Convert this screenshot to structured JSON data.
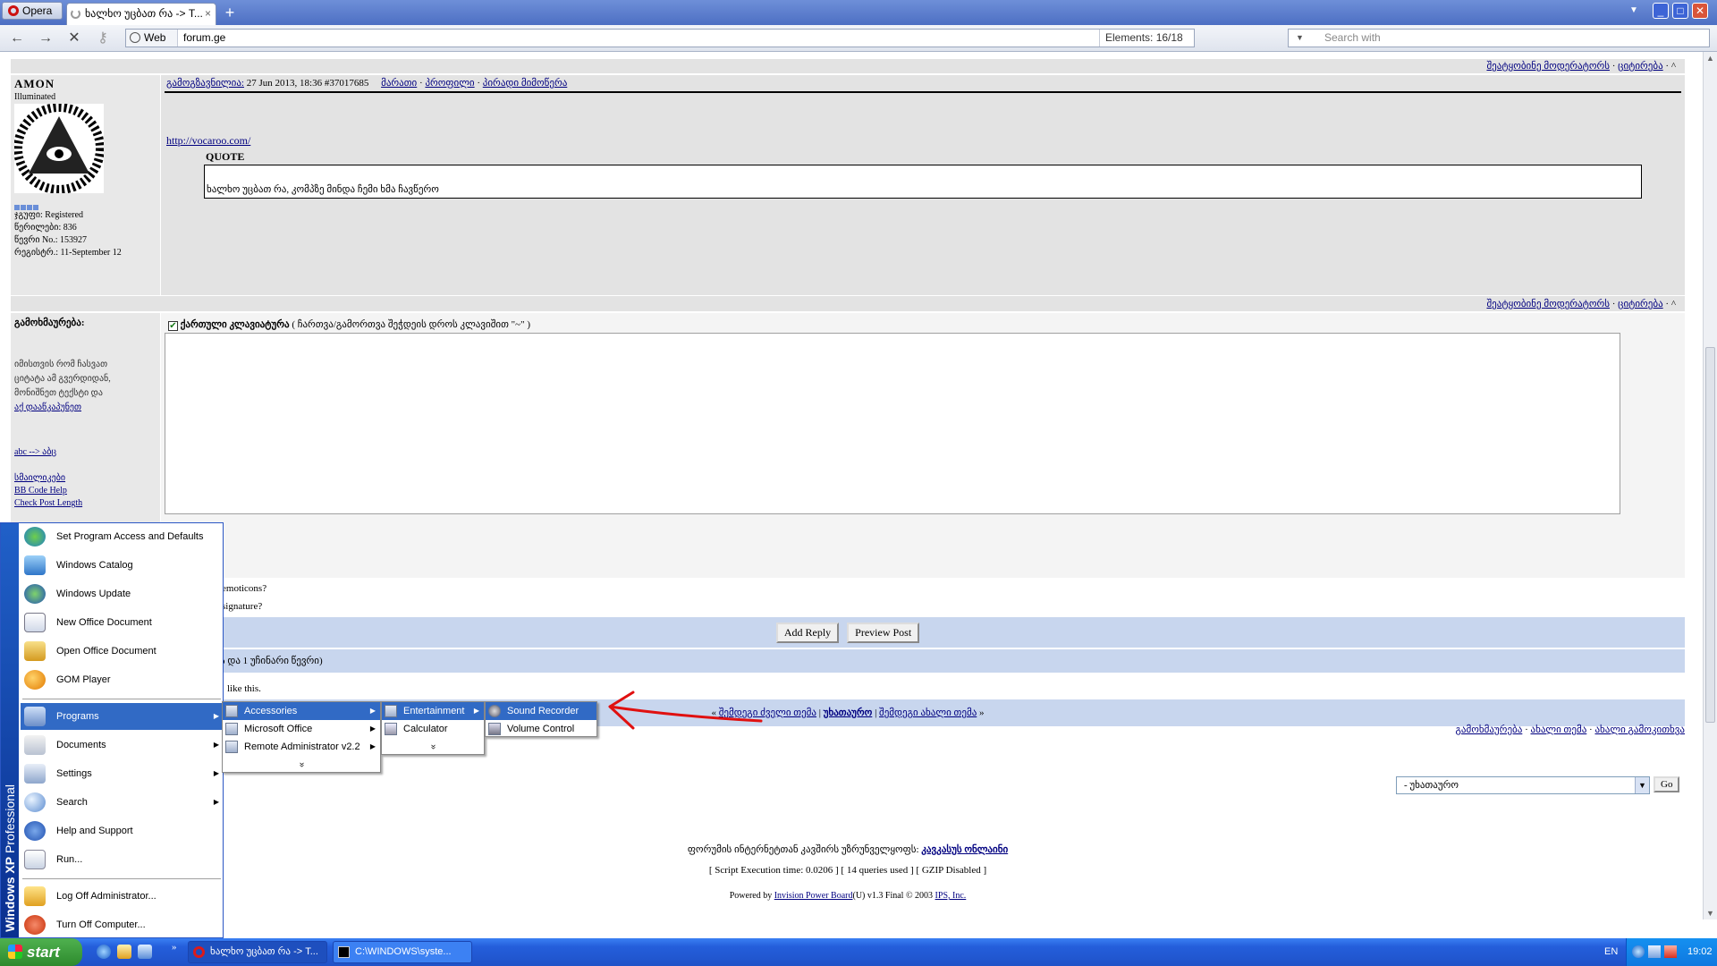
{
  "browser": {
    "menu_label": "Opera",
    "tab_title": "ხალხო უცბათ რა -> T...",
    "tab_close": "×",
    "new_tab": "+",
    "addr_web": "Web",
    "address": "forum.ge",
    "elements": "Elements:   16/18",
    "search_placeholder": "Search with"
  },
  "post": {
    "bar_links": [
      "შეატყობინე მოდერატორს",
      "ციტირება"
    ],
    "author": "AMON",
    "rank": "Illuminated",
    "info": [
      "ჯგუფი: Registered",
      "წერილები: 836",
      "წევრი No.: 153927",
      "რეგისტრ.: 11-September 12"
    ],
    "header_link": "გამოგზავნილია:",
    "header_date": "27 Jun 2013, 18:36",
    "header_num": "#37017685",
    "header_links": [
      "მარათი",
      "პროფილი",
      "პირადი მიმოწერა"
    ],
    "url": "http://vocaroo.com/",
    "quote_label": "QUOTE",
    "quote_text": "ხალხო უცბათ რა, კომპზე მინდა ჩემი ხმა ჩავწერო"
  },
  "reply": {
    "left_title": "გამოხმაურება:",
    "left_hint": [
      "იმისთვის რომ ჩასვათ",
      "ციტატა ამ გვერდიდან,",
      "მონიშნეთ ტექსტი და"
    ],
    "left_links": [
      "აქ დააწკაპუნეთ",
      "abc --> აბც",
      "სმაილიკები",
      "BB Code Help",
      "Check Post Length"
    ],
    "keyboard_label": "ქართული კლავიატურა",
    "keyboard_hint": " ( ჩართვა/გამორთვა შეჭდეის დროს კლავიშით \"~\" )",
    "emoticons": "emoticons?",
    "signature": "signature?",
    "add_reply": "Add Reply",
    "preview": "Preview Post",
    "users_line": "ა და 1 უჩინარი წევრი)",
    "likes": "like this."
  },
  "navigation": {
    "prev_topic": "შემდეგი ძველი თემა",
    "main": "უხათაურო",
    "next_topic": "შემდეგი ახალი თემა",
    "right_links": [
      "გამოხმაურება",
      "ახალი თემა",
      "ახალი გამოკითხვა"
    ],
    "jump_value": "- უხათაურო",
    "go": "Go"
  },
  "footer": {
    "support_prefix": "ფორუმის ინტერნეტთან კავშირს უზრუნველყოფს:",
    "support_link": "კავკასუს ონლაინი",
    "stats": "[ Script Execution time: 0.0206 ]   [ 14 queries used ]   [ GZIP Disabled ]",
    "powered_prefix": "Powered by ",
    "powered_link": "Invision Power Board",
    "powered_mid": "(U) v1.3 Final © 2003  ",
    "ips": "IPS, Inc."
  },
  "startmenu": {
    "side_bold": "Windows XP",
    "side_light": "Professional",
    "items": [
      {
        "label": "Set Program Access and Defaults",
        "arrow": false
      },
      {
        "label": "Windows Catalog",
        "arrow": false
      },
      {
        "label": "Windows Update",
        "arrow": false
      },
      {
        "label": "New Office Document",
        "arrow": false
      },
      {
        "label": "Open Office Document",
        "arrow": false
      },
      {
        "label": "GOM Player",
        "arrow": false
      },
      {
        "label": "Programs",
        "arrow": true
      },
      {
        "label": "Documents",
        "arrow": true
      },
      {
        "label": "Settings",
        "arrow": true
      },
      {
        "label": "Search",
        "arrow": true
      },
      {
        "label": "Help and Support",
        "arrow": false
      },
      {
        "label": "Run...",
        "arrow": false
      },
      {
        "label": "Log Off Administrator...",
        "arrow": false
      },
      {
        "label": "Turn Off Computer...",
        "arrow": false
      }
    ],
    "programs": [
      "Accessories",
      "Microsoft Office",
      "Remote Administrator v2.2"
    ],
    "accessories": [
      "Entertainment",
      "Calculator"
    ],
    "entertainment": [
      "Sound Recorder",
      "Volume Control"
    ],
    "more": "»"
  },
  "taskbar": {
    "start": "start",
    "tasks": [
      "ხალხო უცბათ რა -> T...",
      "C:\\WINDOWS\\syste..."
    ],
    "lang": "EN",
    "clock": "19:02"
  },
  "colors": {
    "highlight": "#316ac5",
    "annotation_arrow": "#e01010",
    "forum_bar": "#c8d6ee"
  }
}
